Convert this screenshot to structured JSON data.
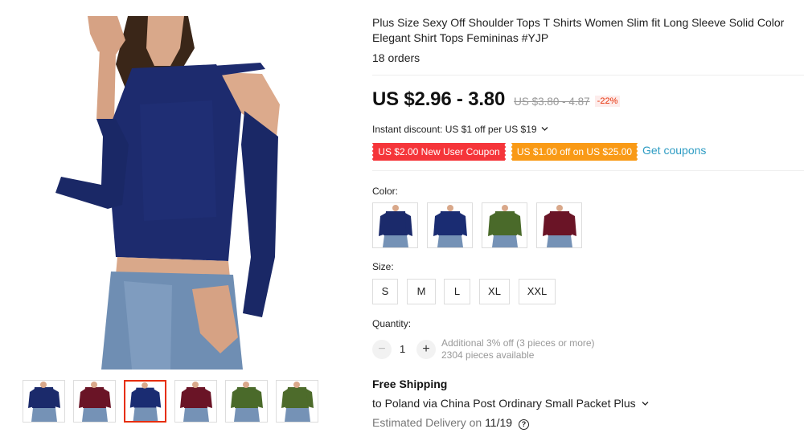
{
  "product": {
    "title": "Plus Size Sexy Off Shoulder Tops T Shirts Women Slim fit Long Sleeve Solid Color Elegant Shirt Tops Femininas #YJP",
    "orders": "18 orders"
  },
  "price": {
    "current": "US $2.96 - 3.80",
    "original": "US $3.80 - 4.87",
    "discount": "-22%"
  },
  "promo": {
    "instant_discount": "Instant discount: US $1 off per US $19",
    "chevron_icon": "chevron-down-icon",
    "coupon_new_user": "US $2.00 New User Coupon",
    "coupon_off": "US $1.00 off on US $25.00",
    "get_coupons": "Get coupons"
  },
  "color": {
    "label": "Color:",
    "options": [
      {
        "name": "navy",
        "hex": "#1b2a6b"
      },
      {
        "name": "navy",
        "hex": "#1a2c72"
      },
      {
        "name": "army green",
        "hex": "#4a6a2a"
      },
      {
        "name": "burgundy",
        "hex": "#6a1426"
      }
    ]
  },
  "size": {
    "label": "Size:",
    "options": [
      "S",
      "M",
      "L",
      "XL",
      "XXL"
    ]
  },
  "quantity": {
    "label": "Quantity:",
    "value": "1",
    "minus": "−",
    "plus": "+",
    "bulk_note": "Additional 3% off (3 pieces or more)",
    "available": "2304 pieces available"
  },
  "shipping": {
    "title": "Free Shipping",
    "destination": "to Poland via China Post Ordinary Small Packet Plus",
    "delivery_prefix": "Estimated Delivery on",
    "delivery_date": "11/19",
    "help_icon": "?"
  },
  "gallery": {
    "main_color": "#1d2b6e",
    "thumbnails": [
      {
        "hex": "#1b2a6b",
        "selected": false
      },
      {
        "hex": "#6a1426",
        "selected": false
      },
      {
        "hex": "#1a2c72",
        "selected": true
      },
      {
        "hex": "#6a1426",
        "selected": false
      },
      {
        "hex": "#4a6a2a",
        "selected": false
      },
      {
        "hex": "#4d6b2b",
        "selected": false
      }
    ]
  },
  "colors": {
    "accent_red": "#e62e04",
    "coupon_red": "#f5353a",
    "coupon_orange": "#f99a16",
    "link_blue": "#2e9cc3"
  }
}
